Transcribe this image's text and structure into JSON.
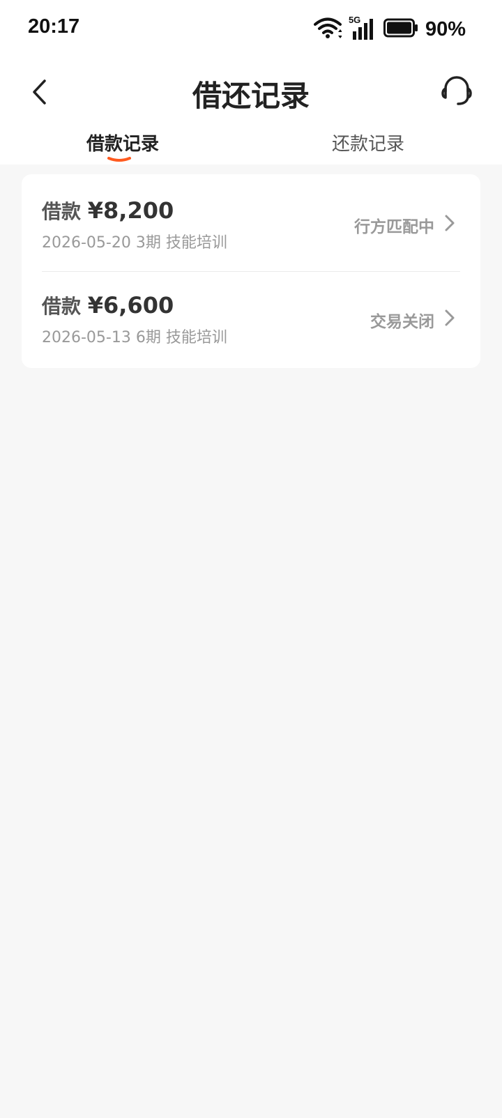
{
  "status_bar": {
    "time": "20:17",
    "network": "5G",
    "battery": "90%",
    "icons": [
      "wifi-icon",
      "signal-5g-icon",
      "battery-icon"
    ]
  },
  "nav": {
    "title": "借还记录",
    "back_icon": "chevron-left-icon",
    "support_icon": "headset-icon"
  },
  "tabs": [
    {
      "label": "借款记录",
      "active": true
    },
    {
      "label": "还款记录",
      "active": false
    }
  ],
  "records": [
    {
      "type_label": "借款",
      "amount": "¥8,200",
      "date": "2026-05-20",
      "term": "3期",
      "purpose": "技能培训",
      "status": "行方匹配中"
    },
    {
      "type_label": "借款",
      "amount": "¥6,600",
      "date": "2026-05-13",
      "term": "6期",
      "purpose": "技能培训",
      "status": "交易关闭"
    }
  ],
  "colors": {
    "accent": "#ff5a1f",
    "page_bg": "#f7f7f7",
    "card_bg": "#ffffff",
    "muted_text": "#999999"
  }
}
